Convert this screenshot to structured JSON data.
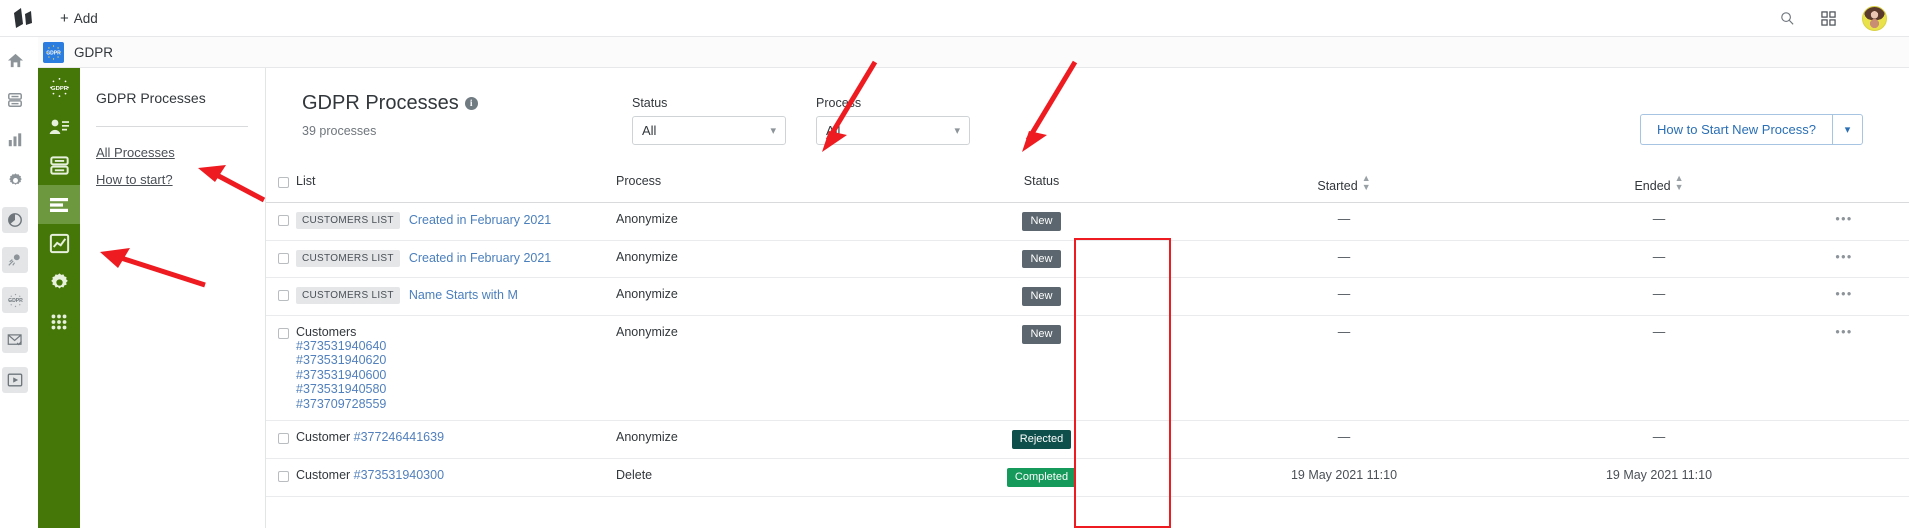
{
  "topbar": {
    "add_label": "Add",
    "logo_name": "app-logo",
    "search_icon": "search-icon",
    "apps_icon": "apps-grid-icon",
    "avatar_name": "user-avatar"
  },
  "rail": {
    "items": [
      {
        "name": "home-icon",
        "boxed": false
      },
      {
        "name": "database-icon",
        "boxed": false
      },
      {
        "name": "analytics-bars-icon",
        "boxed": false
      },
      {
        "name": "settings-gear-icon",
        "boxed": false
      },
      {
        "name": "pie-segment-icon",
        "boxed": true
      },
      {
        "name": "campaign-burst-icon",
        "boxed": true
      },
      {
        "name": "gdpr-icon",
        "boxed": true
      },
      {
        "name": "mail-check-icon",
        "boxed": true
      },
      {
        "name": "video-play-icon",
        "boxed": true
      }
    ]
  },
  "greenbar": {
    "items": [
      {
        "name": "gdpr-badge-icon",
        "active": false
      },
      {
        "name": "contacts-icon",
        "active": false
      },
      {
        "name": "lists-database-icon",
        "active": false
      },
      {
        "name": "processes-lines-icon",
        "active": true
      },
      {
        "name": "chart-trend-icon",
        "active": false
      },
      {
        "name": "gear-icon",
        "active": false
      },
      {
        "name": "apps-dots-icon",
        "active": false
      }
    ]
  },
  "breadcrumb": {
    "app_icon": "gdpr-app-icon",
    "app_name": "GDPR"
  },
  "sidebar": {
    "title": "GDPR Processes",
    "links": [
      {
        "label": "All Processes"
      },
      {
        "label": "How to start?"
      }
    ]
  },
  "page": {
    "title": "GDPR Processes",
    "info_icon": "info-icon",
    "subtitle": "39 processes"
  },
  "filters": [
    {
      "label": "Status",
      "value": "All",
      "name": "status-filter"
    },
    {
      "label": "Process",
      "value": "All",
      "name": "process-filter"
    }
  ],
  "actions": {
    "how_to_start": "How to Start New Process?",
    "caret": "⌄"
  },
  "table": {
    "headers": {
      "list": "List",
      "process": "Process",
      "status": "Status",
      "started": "Started",
      "ended": "Ended"
    },
    "rows": [
      {
        "tag": "CUSTOMERS LIST",
        "name": "Created in February 2021",
        "name_is_link": true,
        "ids": [],
        "process": "Anonymize",
        "status": "New",
        "status_color": "#5b666e",
        "started": "—",
        "ended": "—",
        "more": "•••"
      },
      {
        "tag": "CUSTOMERS LIST",
        "name": "Created in February 2021",
        "name_is_link": true,
        "ids": [],
        "process": "Anonymize",
        "status": "New",
        "status_color": "#5b666e",
        "started": "—",
        "ended": "—",
        "more": "•••"
      },
      {
        "tag": "CUSTOMERS LIST",
        "name": "Name Starts with M",
        "name_is_link": true,
        "ids": [],
        "process": "Anonymize",
        "status": "New",
        "status_color": "#5b666e",
        "started": "—",
        "ended": "—",
        "more": "•••"
      },
      {
        "tag": "",
        "name": "Customers",
        "name_is_link": false,
        "ids": [
          "#373531940640",
          "#373531940620",
          "#373531940600",
          "#373531940580",
          "#373709728559"
        ],
        "process": "Anonymize",
        "status": "New",
        "status_color": "#5b666e",
        "started": "—",
        "ended": "—",
        "more": "•••"
      },
      {
        "tag": "",
        "name": "Customer ",
        "name_is_link": false,
        "name_link_part": "#377246441639",
        "ids": [],
        "process": "Anonymize",
        "status": "Rejected",
        "status_color": "#0e4f4b",
        "started": "—",
        "ended": "—",
        "more": ""
      },
      {
        "tag": "",
        "name": "Customer ",
        "name_is_link": false,
        "name_link_part": "#373531940300",
        "ids": [],
        "process": "Delete",
        "status": "Completed",
        "status_color": "#169a5b",
        "started": "19 May 2021 11:10",
        "ended": "19 May 2021 11:10",
        "more": ""
      }
    ]
  },
  "annotations": {
    "highlight_color": "#ee1b20",
    "arrows": [
      {
        "name": "arrow-to-status-filter"
      },
      {
        "name": "arrow-to-process-filter"
      },
      {
        "name": "arrow-to-all-processes"
      },
      {
        "name": "arrow-to-processes-nav"
      }
    ],
    "box": {
      "name": "status-column-highlight-box"
    }
  }
}
